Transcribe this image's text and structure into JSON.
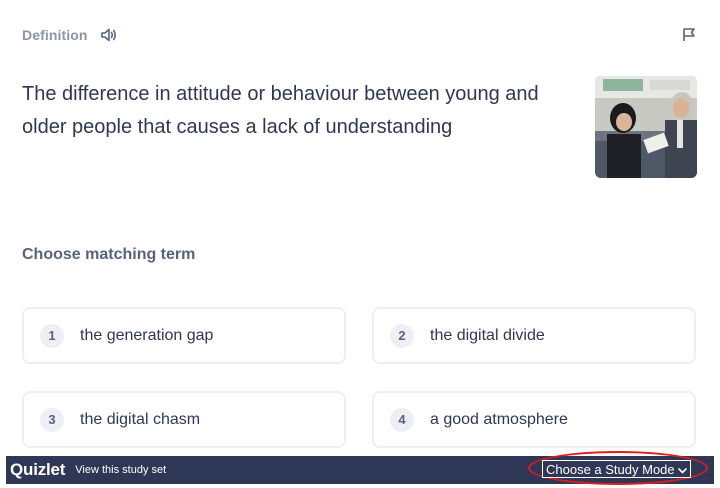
{
  "header": {
    "label": "Definition",
    "audio_icon": "speaker-icon",
    "flag_icon": "flag-icon"
  },
  "definition": {
    "text": "The difference in attitude or behaviour between young and older people that causes a lack of understanding",
    "image_alt": "photo of a young man and an older man reading on a train"
  },
  "prompt": "Choose matching term",
  "options": [
    {
      "num": "1",
      "text": "the generation gap"
    },
    {
      "num": "2",
      "text": "the digital divide"
    },
    {
      "num": "3",
      "text": "the digital chasm"
    },
    {
      "num": "4",
      "text": "a good atmosphere"
    }
  ],
  "footer": {
    "brand": "Quizlet",
    "view_link": "View this study set",
    "mode_select": "Choose a Study Mode"
  },
  "colors": {
    "text_primary": "#2e3856",
    "text_muted": "#586380",
    "label_gray": "#8d94ac",
    "border": "#edeff4",
    "footer_bg": "#2e3856",
    "highlight_red": "#e21b1b"
  }
}
